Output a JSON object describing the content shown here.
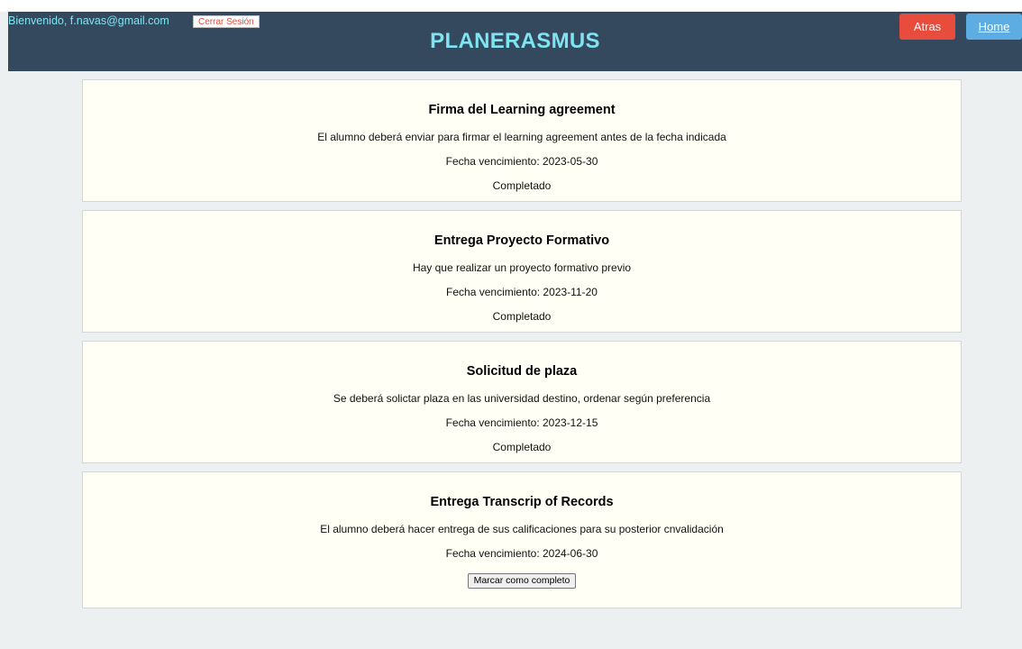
{
  "header": {
    "welcome": "Bienvenido, f.navas@gmail.com",
    "logout_label": "Cerrar Sesión",
    "title": "PLANERASMUS",
    "back_label": "Atras",
    "home_label": "Home"
  },
  "tasks": [
    {
      "title": "Firma del Learning agreement",
      "description": "El alumno deberá enviar para firmar el learning agreement antes de la fecha indicada",
      "due": "Fecha vencimiento: 2023-05-30",
      "status": "Completado"
    },
    {
      "title": "Entrega Proyecto Formativo",
      "description": "Hay que realizar un proyecto formativo previo",
      "due": "Fecha vencimiento: 2023-11-20",
      "status": "Completado"
    },
    {
      "title": "Solicitud de plaza",
      "description": "Se deberá solictar plaza en las universidad destino, ordenar según preferencia",
      "due": "Fecha vencimiento: 2023-12-15",
      "status": "Completado"
    },
    {
      "title": "Entrega Transcrip of Records",
      "description": "El alumno deberá hacer entrega de sus calificaciones para su posterior cnvalidación",
      "due": "Fecha vencimiento: 2024-06-30",
      "action_label": "Marcar como completo"
    }
  ],
  "colors": {
    "header_bg": "#34495e",
    "accent_cyan": "#7fe3f1",
    "back_button": "#e74c3c",
    "home_button": "#5dade2",
    "card_bg": "#fffff6",
    "page_bg": "#ecf0f1"
  }
}
